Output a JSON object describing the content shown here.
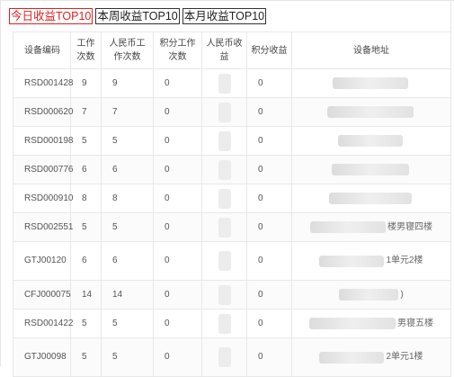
{
  "tabs": [
    {
      "label": "今日收益TOP10",
      "active": true
    },
    {
      "label": "本周收益TOP10",
      "active": false
    },
    {
      "label": "本月收益TOP10",
      "active": false
    }
  ],
  "table": {
    "headers": {
      "code": "设备编码",
      "work": "工作次数",
      "rmb_work": "人民币工作次数",
      "points_work": "积分工作次数",
      "rmb_income": "人民币收益",
      "points_income": "积分收益",
      "address": "设备地址"
    },
    "rows": [
      {
        "code": "RSD001428",
        "work": "9",
        "rmb_work": "9",
        "points_work": "0",
        "points_income": "0",
        "address_tail": ""
      },
      {
        "code": "RSD000620",
        "work": "7",
        "rmb_work": "7",
        "points_work": "0",
        "points_income": "0",
        "address_tail": ""
      },
      {
        "code": "RSD000198",
        "work": "5",
        "rmb_work": "5",
        "points_work": "0",
        "points_income": "0",
        "address_tail": ""
      },
      {
        "code": "RSD000776",
        "work": "6",
        "rmb_work": "6",
        "points_work": "0",
        "points_income": "0",
        "address_tail": ""
      },
      {
        "code": "RSD000910",
        "work": "8",
        "rmb_work": "8",
        "points_work": "0",
        "points_income": "0",
        "address_tail": ""
      },
      {
        "code": "RSD002551",
        "work": "5",
        "rmb_work": "5",
        "points_work": "0",
        "points_income": "0",
        "address_tail": "楼男寝四楼"
      },
      {
        "code": "GTJ00120",
        "work": "6",
        "rmb_work": "6",
        "points_work": "0",
        "points_income": "0",
        "address_tail": "1单元2楼"
      },
      {
        "code": "CFJ000075",
        "work": "14",
        "rmb_work": "14",
        "points_work": "0",
        "points_income": "0",
        "address_tail": ")"
      },
      {
        "code": "RSD001422",
        "work": "5",
        "rmb_work": "5",
        "points_work": "0",
        "points_income": "0",
        "address_tail": "男寝五楼"
      },
      {
        "code": "GTJ00098",
        "work": "5",
        "rmb_work": "5",
        "points_work": "0",
        "points_income": "0",
        "address_tail": "2单元1楼"
      }
    ]
  }
}
